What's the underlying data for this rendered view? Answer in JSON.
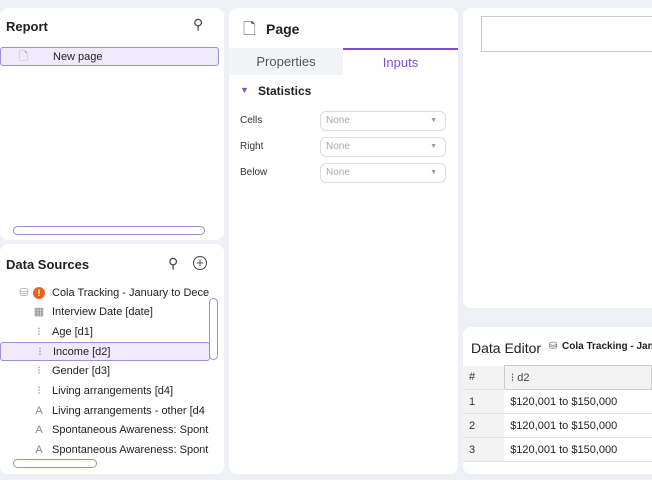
{
  "report": {
    "title": "Report",
    "pages": [
      {
        "label": "New page"
      }
    ]
  },
  "data_sources": {
    "title": "Data Sources",
    "dataset": "Cola Tracking - January to Dece",
    "items": [
      {
        "label": "Interview Date [date]",
        "icon": "calendar-icon"
      },
      {
        "label": "Age [d1]",
        "icon": "categorical-icon"
      },
      {
        "label": "Income [d2]",
        "icon": "categorical-icon",
        "selected": true
      },
      {
        "label": "Gender [d3]",
        "icon": "categorical-icon"
      },
      {
        "label": "Living arrangements [d4]",
        "icon": "categorical-icon"
      },
      {
        "label": "Living arrangements - other [d4",
        "icon": "text-icon"
      },
      {
        "label": "Spontaneous Awareness: Spont",
        "icon": "text-icon"
      },
      {
        "label": "Spontaneous Awareness: Spont",
        "icon": "text-icon"
      }
    ]
  },
  "page_panel": {
    "title": "Page",
    "tabs": [
      {
        "label": "Properties"
      },
      {
        "label": "Inputs",
        "active": true
      }
    ],
    "section": "Statistics",
    "fields": [
      {
        "label": "Cells",
        "value": "None"
      },
      {
        "label": "Right",
        "value": "None"
      },
      {
        "label": "Below",
        "value": "None"
      }
    ]
  },
  "data_editor": {
    "title": "Data Editor",
    "dataset": "Cola Tracking - Janu",
    "columns": [
      "#",
      "d2"
    ],
    "rows": [
      [
        "1",
        "$120,001 to $150,000"
      ],
      [
        "2",
        "$120,001 to $150,000"
      ],
      [
        "3",
        "$120,001 to $150,000"
      ]
    ]
  },
  "colors": {
    "accent": "#7b4fd8",
    "warning": "#e8641c"
  }
}
